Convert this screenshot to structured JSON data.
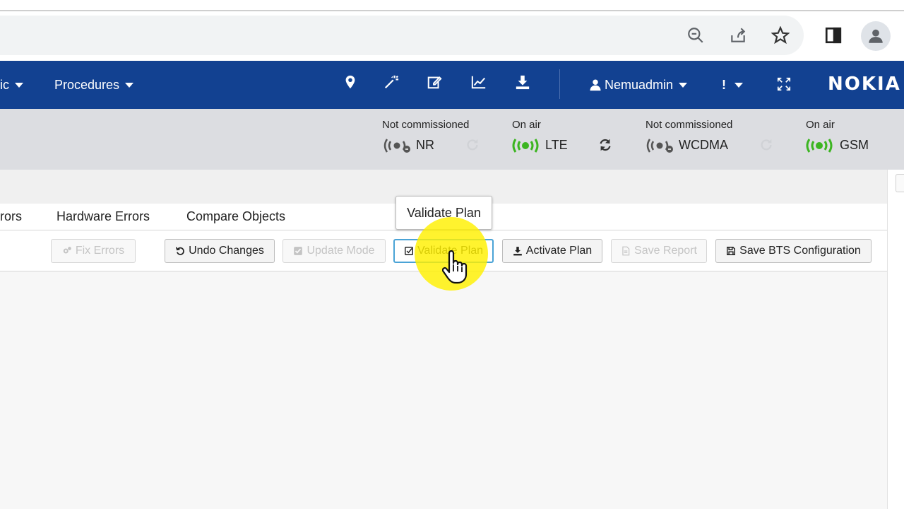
{
  "browser": {
    "icons": [
      "zoom-icon",
      "share-icon",
      "bookmark-star-icon",
      "side-panel-icon",
      "profile-icon"
    ]
  },
  "nav": {
    "partial_item": "ic",
    "procedures": "Procedures",
    "user": "Nemuadmin",
    "alert": "!",
    "logo": "NOKIA",
    "icons": [
      "map-pin-icon",
      "magic-wand-icon",
      "edit-icon",
      "chart-line-icon",
      "download-icon",
      "user-icon",
      "fullscreen-icon"
    ]
  },
  "status": {
    "nr": {
      "label": "Not commissioned",
      "tech": "NR",
      "color": "#555555"
    },
    "lte": {
      "label": "On air",
      "tech": "LTE",
      "color": "#3cb521"
    },
    "wcdma": {
      "label": "Not commissioned",
      "tech": "WCDMA",
      "color": "#555555"
    },
    "gsm": {
      "label": "On air",
      "tech": "GSM",
      "color": "#3cb521"
    }
  },
  "tabs": {
    "partial_errors": "rors",
    "hardware_errors": "Hardware Errors",
    "compare_objects": "Compare Objects"
  },
  "toolbar": {
    "fix_errors": "Fix Errors",
    "undo_changes": "Undo Changes",
    "update_mode": "Update Mode",
    "validate_plan": "Validate Plan",
    "activate_plan": "Activate Plan",
    "save_report": "Save Report",
    "save_bts": "Save BTS Configuration"
  },
  "tooltip": {
    "text": "Validate Plan"
  },
  "colors": {
    "nav_bg": "#124191",
    "status_bg": "#dcdde1",
    "on_air": "#3cb521",
    "focus_border": "#4aa3d6",
    "cursor_highlight": "#fff000"
  }
}
